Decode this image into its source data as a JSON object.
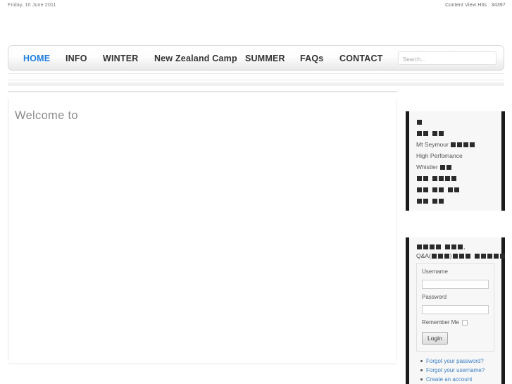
{
  "topbar": {
    "date": "Friday, 10 June 2011",
    "hits_label": "Content View Hits :",
    "hits_value": "34397"
  },
  "nav": {
    "items": [
      {
        "label": "HOME",
        "active": true
      },
      {
        "label": "INFO",
        "active": false
      },
      {
        "label": "WINTER",
        "active": false
      },
      {
        "label": "New Zealand Camp",
        "active": false
      },
      {
        "label": "SUMMER",
        "active": false
      },
      {
        "label": "FAQs",
        "active": false
      },
      {
        "label": "CONTACT",
        "active": false
      }
    ],
    "search": {
      "placeholder": "Search...",
      "value": ""
    }
  },
  "main": {
    "heading": "Welcome to"
  },
  "sidebar": {
    "links_module": {
      "rows": [
        {
          "text": "",
          "boxes": [
            1
          ]
        },
        {
          "text": "",
          "boxes": [
            2,
            2
          ]
        },
        {
          "text": "Mt Seymour",
          "boxes": [
            4
          ]
        },
        {
          "text": "High Perfomance",
          "boxes": []
        },
        {
          "text": "Whistler",
          "boxes": [
            2
          ]
        },
        {
          "text": "",
          "boxes": [
            2,
            4
          ]
        },
        {
          "text": "",
          "boxes": [
            2,
            2,
            2
          ]
        },
        {
          "text": "",
          "boxes": [
            2,
            2
          ]
        }
      ]
    },
    "login_module": {
      "title_line1_boxes": [
        4,
        3
      ],
      "title_line1_suffix": ",",
      "title_line2_prefix": "Q&A(",
      "title_line2_boxes_a": [
        3
      ],
      "title_line2_mid": ")",
      "title_line2_boxes_b": [
        3,
        5
      ],
      "username_label": "Username",
      "username_value": "",
      "password_label": "Password",
      "password_value": "",
      "remember_label": "Remember Me",
      "remember_checked": false,
      "login_button": "Login",
      "links": [
        "Forgot your password?",
        "Forgot your username?",
        "Create an account"
      ]
    }
  },
  "colors": {
    "accent_blue": "#1f7fe0",
    "link_blue": "#3b7fc4",
    "module_bar": "#1a1a1a"
  }
}
